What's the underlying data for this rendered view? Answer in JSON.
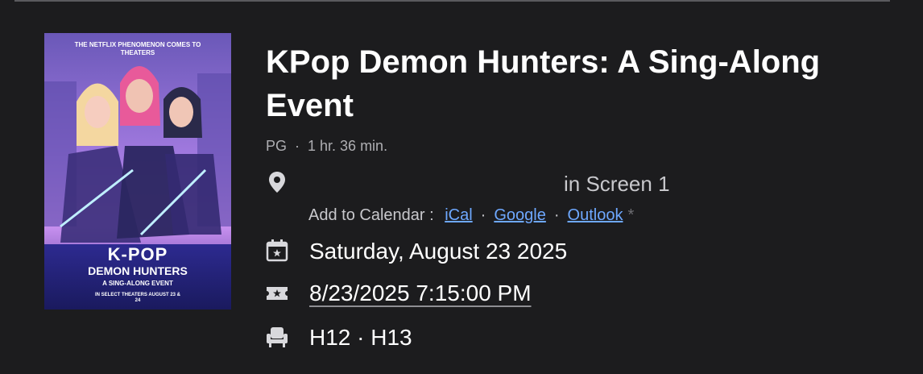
{
  "movie": {
    "title": "KPop Demon Hunters: A Sing-Along Event",
    "rating": "PG",
    "runtime": "1 hr. 36 min.",
    "separator": "·",
    "poster_alt": "KPOP DEMON HUNTERS A SING-ALONG EVENT poster",
    "poster_tagline": "THE NETFLIX PHENOMENON COMES TO THEATERS",
    "poster_title_line1": "K-POP",
    "poster_title_line2": "DEMON HUNTERS",
    "poster_subtitle": "A SING-ALONG EVENT",
    "poster_dates": "IN SELECT THEATERS AUGUST 23 & 24"
  },
  "location": {
    "icon": "map-pin-icon",
    "text": "in Screen 1"
  },
  "calendar": {
    "label": "Add to Calendar :",
    "links": [
      "iCal",
      "Google",
      "Outlook"
    ],
    "dot": "·",
    "star": "*"
  },
  "showtime": {
    "date_icon": "calendar-icon",
    "date": "Saturday, August 23 2025",
    "ticket_icon": "ticket-icon",
    "datetime": "8/23/2025 7:15:00 PM"
  },
  "seats": {
    "icon": "seat-icon",
    "text": "H12 · H13"
  },
  "colors": {
    "background": "#1c1c1e",
    "link": "#6ea8ff",
    "muted": "#aeaeb2"
  }
}
